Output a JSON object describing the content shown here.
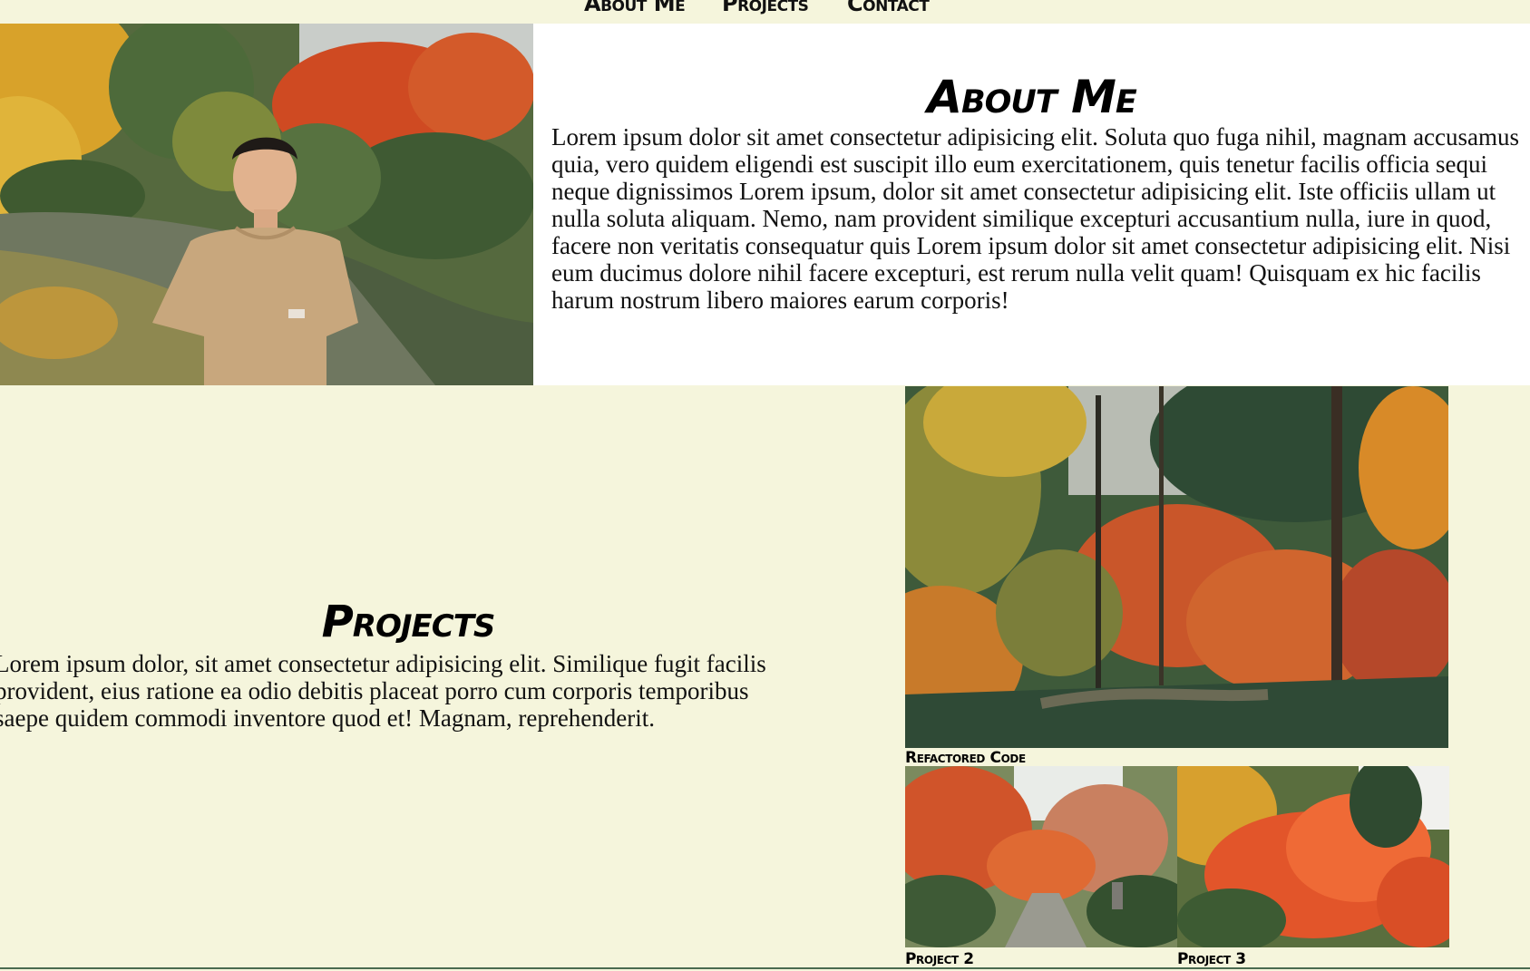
{
  "nav": {
    "items": [
      {
        "label": "About Me"
      },
      {
        "label": "Projects"
      },
      {
        "label": "Contact"
      }
    ]
  },
  "about": {
    "title": "About Me",
    "body": "Lorem ipsum dolor sit amet consectetur adipisicing elit. Soluta quo fuga nihil, magnam accusamus quia, vero quidem eligendi est suscipit illo eum exercitationem, quis tenetur facilis officia sequi neque dignissimos Lorem ipsum, dolor sit amet consectetur adipisicing elit. Iste officiis ullam ut nulla soluta aliquam. Nemo, nam provident similique excepturi accusantium nulla, iure in quod, facere non veritatis consequatur quis Lorem ipsum dolor sit amet consectetur adipisicing elit. Nisi eum ducimus dolore nihil facere excepturi, est rerum nulla velit quam! Quisquam ex hic facilis harum nostrum libero maiores earum corporis!"
  },
  "projects": {
    "title": "Projects",
    "body": "Lorem ipsum dolor, sit amet consectetur adipisicing elit. Similique fugit facilis provident, eius ratione ea odio debitis placeat porro cum corporis temporibus saepe quidem commodi inventore quod et! Magnam, reprehenderit.",
    "cards": [
      {
        "caption": "Refactored Code"
      },
      {
        "caption": "Project 2"
      },
      {
        "caption": "Project 3"
      }
    ]
  },
  "colors": {
    "page_background": "#f5f5dc",
    "about_panel_background": "#ffffff",
    "text": "#111111",
    "bottom_rule": "#4a6b50"
  }
}
